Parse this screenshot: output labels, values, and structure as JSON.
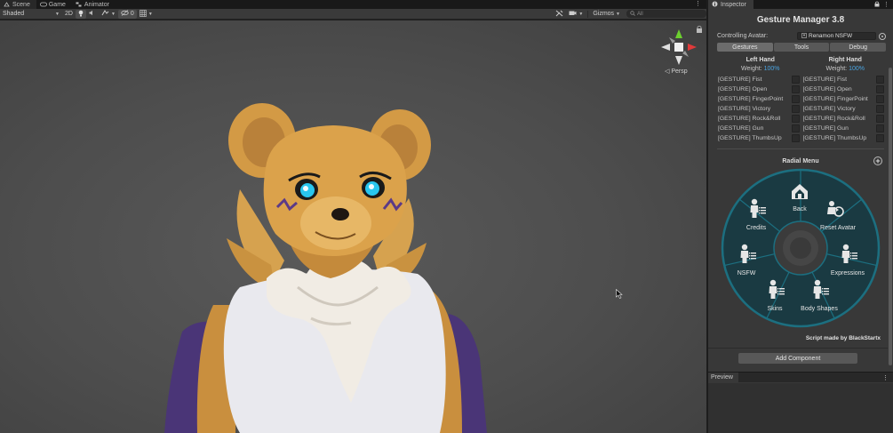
{
  "tabs": [
    {
      "label": "Scene",
      "icon": "scene-icon",
      "active": true
    },
    {
      "label": "Game",
      "icon": "game-icon",
      "active": false
    },
    {
      "label": "Animator",
      "icon": "animator-icon",
      "active": false
    }
  ],
  "scene_toolbar": {
    "draw_mode": "Shaded",
    "mode_2d": "2D",
    "hidden_count": "0",
    "gizmos_label": "Gizmos",
    "search_placeholder": "All"
  },
  "viewport": {
    "projection_label": "◁ Persp"
  },
  "inspector": {
    "tab_label": "Inspector",
    "title": "Gesture Manager 3.8",
    "controlling_label": "Controlling Avatar:",
    "controlling_value": "Renamon NSFW",
    "subtabs": [
      "Gestures",
      "Tools",
      "Debug"
    ],
    "left_hand": {
      "title": "Left Hand",
      "weight_label": "Weight:",
      "weight_value": "100%",
      "gestures": [
        "[GESTURE] Fist",
        "[GESTURE] Open",
        "[GESTURE] FingerPoint",
        "[GESTURE] Victory",
        "[GESTURE] Rock&Roll",
        "[GESTURE] Gun",
        "[GESTURE] ThumbsUp"
      ]
    },
    "right_hand": {
      "title": "Right Hand",
      "weight_label": "Weight:",
      "weight_value": "100%",
      "gestures": [
        "[GESTURE] Fist",
        "[GESTURE] Open",
        "[GESTURE] FingerPoint",
        "[GESTURE] Victory",
        "[GESTURE] Rock&Roll",
        "[GESTURE] Gun",
        "[GESTURE] ThumbsUp"
      ]
    },
    "radial_menu": {
      "title": "Radial Menu",
      "items": [
        {
          "label": "Back",
          "icon": "home-icon"
        },
        {
          "label": "Reset Avatar",
          "icon": "reset-avatar-icon"
        },
        {
          "label": "Expressions",
          "icon": "person-menu-icon"
        },
        {
          "label": "Body Shapes",
          "icon": "person-menu-icon"
        },
        {
          "label": "Skins",
          "icon": "person-menu-icon"
        },
        {
          "label": "NSFW",
          "icon": "person-menu-icon"
        },
        {
          "label": "Credits",
          "icon": "person-menu-icon"
        }
      ]
    },
    "credit": "Script made by BlackStartx",
    "add_component": "Add Component",
    "preview_label": "Preview"
  },
  "colors": {
    "accent_blue": "#4aa3e0",
    "radial_teal": "#1c6f80",
    "radial_fill": "#1a3a42"
  }
}
